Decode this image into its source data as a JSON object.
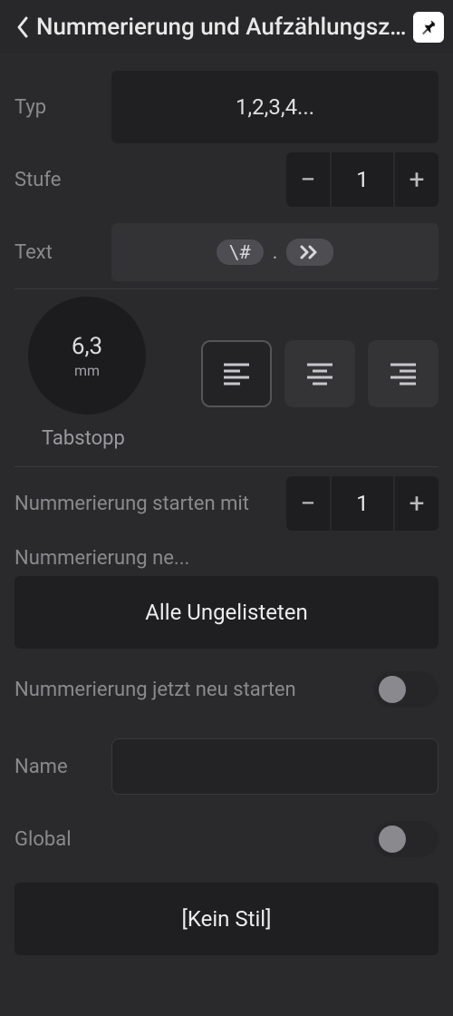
{
  "header": {
    "title": "Nummerierung und Aufzählungszeichen"
  },
  "type": {
    "label": "Typ",
    "value": "1,2,3,4..."
  },
  "level": {
    "label": "Stufe",
    "value": "1"
  },
  "text": {
    "label": "Text",
    "token1": "\\#",
    "separator": ".",
    "token2_icon": "double-chevron-right"
  },
  "tabstop": {
    "value": "6,3",
    "unit": "mm",
    "label": "Tabstopp",
    "alignment": "left"
  },
  "start": {
    "label": "Nummerierung starten mit",
    "value": "1"
  },
  "restartAfter": {
    "label": "Nummerierung ne...",
    "button": "Alle Ungelisteten"
  },
  "restartNow": {
    "label": "Nummerierung jetzt neu starten",
    "value": false
  },
  "name": {
    "label": "Name",
    "value": ""
  },
  "global": {
    "label": "Global",
    "value": false
  },
  "style": {
    "button": "[Kein Stil]"
  }
}
